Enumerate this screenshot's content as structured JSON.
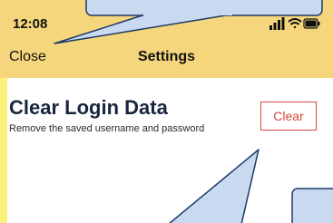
{
  "status_bar": {
    "time": "12:08",
    "icons": [
      "signal-icon",
      "wifi-icon",
      "battery-icon"
    ]
  },
  "nav": {
    "close_label": "Close",
    "title": "Settings"
  },
  "section": {
    "title": "Clear Login Data",
    "description": "Remove the saved username and password",
    "button_label": "Clear"
  },
  "colors": {
    "header_bg": "#f6d67c",
    "accent": "#d24a3a",
    "callout_fill": "#c9d9ef",
    "callout_stroke": "#1c3a66"
  }
}
